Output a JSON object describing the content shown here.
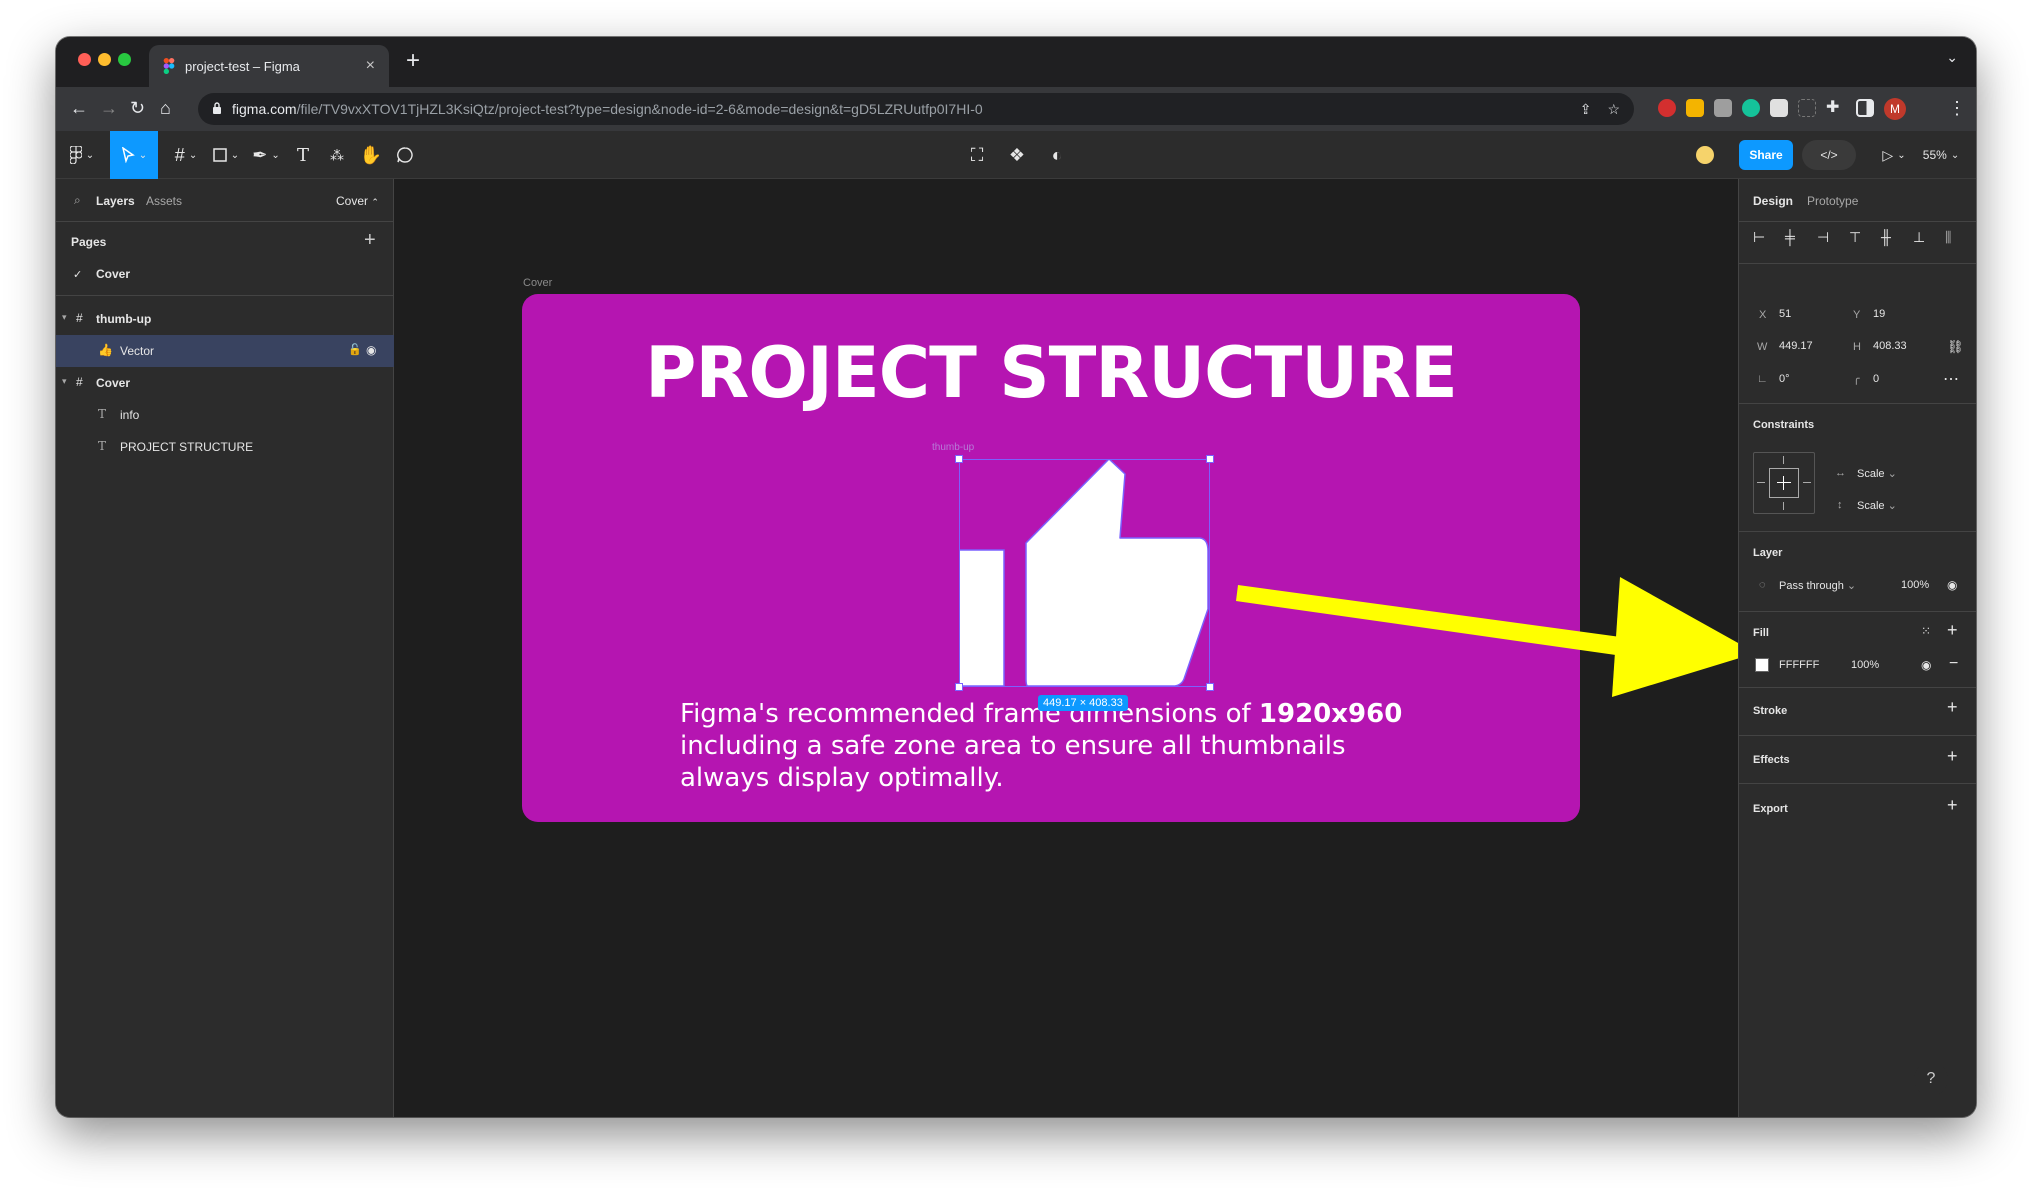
{
  "browser": {
    "tab_title": "project-test – Figma",
    "url_host": "figma.com",
    "url_path": "/file/TV9vxXTOV1TjHZL3KsiQtz/project-test?type=design&node-id=2-6&mode=design&t=gD5LZRUutfp0I7HI-0",
    "profile_initial": "M"
  },
  "toolbar": {
    "share_label": "Share",
    "zoom": "55%"
  },
  "left_panel": {
    "tab_layers": "Layers",
    "tab_assets": "Assets",
    "page_selector": "Cover",
    "pages_heading": "Pages",
    "pages": [
      "Cover"
    ],
    "layers": [
      {
        "name": "thumb-up",
        "kind": "frame"
      },
      {
        "name": "Vector",
        "kind": "vector",
        "selected": true
      },
      {
        "name": "Cover",
        "kind": "frame"
      },
      {
        "name": "info",
        "kind": "text"
      },
      {
        "name": "PROJECT STRUCTURE",
        "kind": "text"
      }
    ]
  },
  "canvas": {
    "frame_label": "Cover",
    "frame_fill": "#B515B1",
    "title": "PROJECT STRUCTURE",
    "selection_label": "thumb-up",
    "selection_size": "449.17 × 408.33",
    "body_text_part1": "Figma's recommended frame dimensions of ",
    "body_text_bold": "1920x960",
    "body_text_part2": " including a safe zone area to ensure all thumbnails always display optimally.",
    "arrow_color": "#FFFF00"
  },
  "right_panel": {
    "tab_design": "Design",
    "tab_prototype": "Prototype",
    "x_label": "X",
    "x_value": "51",
    "y_label": "Y",
    "y_value": "19",
    "w_label": "W",
    "w_value": "449.17",
    "h_label": "H",
    "h_value": "408.33",
    "rotation": "0°",
    "radius": "0",
    "constraints_heading": "Constraints",
    "constraint_h": "Scale",
    "constraint_v": "Scale",
    "layer_heading": "Layer",
    "blend_mode": "Pass through",
    "layer_opacity": "100%",
    "fill_heading": "Fill",
    "fill_hex": "FFFFFF",
    "fill_opacity": "100%",
    "stroke_heading": "Stroke",
    "effects_heading": "Effects",
    "export_heading": "Export"
  },
  "help_label": "?"
}
